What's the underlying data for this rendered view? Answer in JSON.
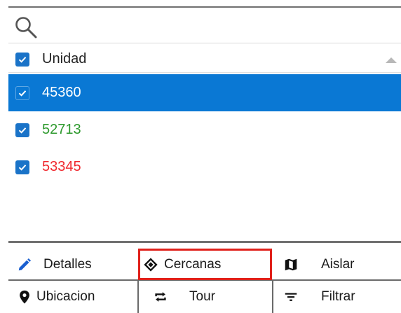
{
  "search": {
    "value": "",
    "placeholder": ""
  },
  "list": {
    "header_label": "Unidad",
    "rows": [
      {
        "value": "45360",
        "color": "#ffffff",
        "selected": true
      },
      {
        "value": "52713",
        "color": "#2e9a2e",
        "selected": false
      },
      {
        "value": "53345",
        "color": "#f0282e",
        "selected": false
      }
    ]
  },
  "toolbar": {
    "detalles": "Detalles",
    "cercanas": "Cercanas",
    "aislar": "Aislar",
    "ubicacion": "Ubicacion",
    "tour": "Tour",
    "filtrar": "Filtrar"
  },
  "colors": {
    "accent": "#0a78d4",
    "checkbox": "#1a73c8",
    "highlight_border": "#e0201a"
  },
  "icons": [
    "search-icon",
    "pencil-icon",
    "diamond-direction-icon",
    "map-icon",
    "location-pin-icon",
    "repeat-icon",
    "filter-lines-icon"
  ]
}
